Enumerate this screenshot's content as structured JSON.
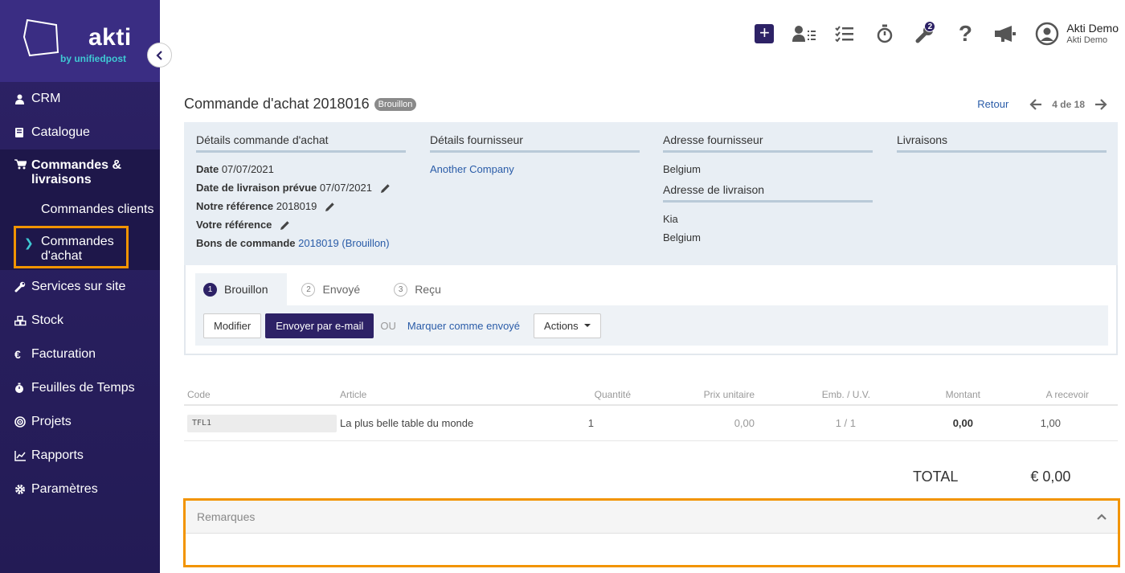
{
  "brand": {
    "logo_word": "akti",
    "logo_sub": "by unifiedpost"
  },
  "sidebar": {
    "items": [
      {
        "label": "CRM",
        "icon": "user-icon"
      },
      {
        "label": "Catalogue",
        "icon": "book-icon"
      }
    ],
    "group": {
      "label": "Commandes & livraisons",
      "icon": "cart-icon",
      "sub_items": [
        {
          "label": "Commandes clients"
        }
      ],
      "active_sub": {
        "label": "Commandes d'achat"
      }
    },
    "items_after": [
      {
        "label": "Services sur site",
        "icon": "wrench-icon"
      },
      {
        "label": "Stock",
        "icon": "cubes-icon"
      },
      {
        "label": "Facturation",
        "icon": "euro-icon"
      },
      {
        "label": "Feuilles de Temps",
        "icon": "stopwatch-icon"
      },
      {
        "label": "Projets",
        "icon": "target-icon"
      },
      {
        "label": "Rapports",
        "icon": "chart-icon"
      },
      {
        "label": "Paramètres",
        "icon": "gear-icon"
      }
    ]
  },
  "topbar": {
    "tools_badge": "2",
    "user_name": "Akti Demo",
    "user_company": "Akti Demo"
  },
  "page": {
    "title": "Commande d'achat 2018016",
    "status": "Brouillon"
  },
  "pager": {
    "back": "Retour",
    "position": "4 de 18"
  },
  "details": {
    "order": {
      "heading": "Détails commande d'achat",
      "date_label": "Date",
      "date": "07/07/2021",
      "delivery_label": "Date de livraison prévue",
      "delivery": "07/07/2021",
      "our_ref_label": "Notre référence",
      "our_ref": "2018019",
      "your_ref_label": "Votre référence",
      "po_label": "Bons de commande",
      "po": "2018019 (Brouillon)"
    },
    "supplier": {
      "heading": "Détails fournisseur",
      "name": "Another Company"
    },
    "address": {
      "heading": "Adresse fournisseur",
      "country": "Belgium",
      "delivery_heading": "Adresse de livraison",
      "delivery_name": "Kia",
      "delivery_country": "Belgium"
    },
    "deliveries": {
      "heading": "Livraisons"
    }
  },
  "steps": [
    {
      "num": "1",
      "label": "Brouillon"
    },
    {
      "num": "2",
      "label": "Envoyé"
    },
    {
      "num": "3",
      "label": "Reçu"
    }
  ],
  "actions": {
    "modify": "Modifier",
    "send_email": "Envoyer par e-mail",
    "or": "OU",
    "mark_sent": "Marquer comme envoyé",
    "actions": "Actions"
  },
  "table": {
    "headers": [
      "Code",
      "Article",
      "Quantité",
      "Prix unitaire",
      "Emb. / U.V.",
      "Montant",
      "A recevoir"
    ],
    "rows": [
      {
        "code": "TFL1",
        "article": "La plus belle table du monde",
        "qty": "1",
        "unit_price": "0,00",
        "pack": "1 / 1",
        "amount": "0,00",
        "to_receive": "1,00"
      }
    ]
  },
  "total": {
    "label": "TOTAL",
    "value": "€ 0,00"
  },
  "remarks": {
    "heading": "Remarques"
  }
}
